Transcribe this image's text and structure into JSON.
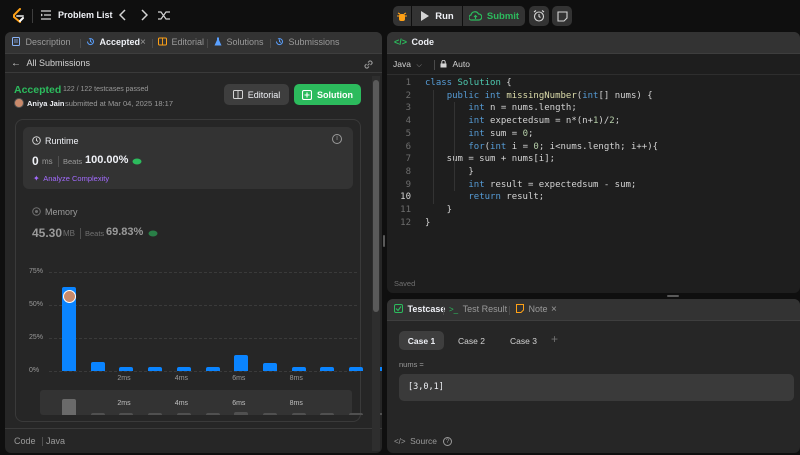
{
  "topbar": {
    "title": "Problem List",
    "run_label": "Run",
    "submit_label": "Submit"
  },
  "left_tabs": {
    "description": "Description",
    "accepted": "Accepted",
    "editorial": "Editorial",
    "solutions": "Solutions",
    "submissions": "Submissions"
  },
  "submission": {
    "back_label": "All Submissions",
    "status": "Accepted",
    "testcases": "122 / 122 testcases passed",
    "user": "Aniya Jain",
    "submitted_at": "submitted at Mar 04, 2025 18:17",
    "editorial_btn": "Editorial",
    "solution_btn": "Solution",
    "runtime_label": "Runtime",
    "runtime_value": "0",
    "runtime_unit": "ms",
    "beats_label": "Beats",
    "runtime_beats": "100.00%",
    "analyze_label": "Analyze Complexity",
    "memory_label": "Memory",
    "memory_value": "45.30",
    "memory_unit": "MB",
    "memory_beats": "69.83%",
    "footer_code": "Code",
    "footer_lang": "Java"
  },
  "chart_data": {
    "type": "bar",
    "ylim": [
      0,
      75
    ],
    "yticks": [
      "75%",
      "50%",
      "25%",
      "0%"
    ],
    "xtick_labels": [
      "2ms",
      "4ms",
      "6ms",
      "8ms"
    ],
    "values": [
      64,
      7,
      3,
      3,
      3,
      3,
      12,
      6,
      3,
      3,
      3,
      3
    ],
    "highlight_index": 0
  },
  "code_panel": {
    "title": "Code",
    "language": "Java",
    "auto_label": "Auto",
    "saved_label": "Saved",
    "lines": [
      "class Solution {",
      "    public int missingNumber(int[] nums) {",
      "        int n = nums.length;",
      "        int expectedsum = n*(n+1)/2;",
      "        int sum = 0;",
      "        for(int i = 0; i<nums.length; i++){",
      "    sum = sum + nums[i];",
      "        }",
      "        int result = expectedsum - sum;",
      "        return result;",
      "    }",
      "}"
    ],
    "active_line": 10
  },
  "test_panel": {
    "testcase_tab": "Testcase",
    "result_tab": "Test Result",
    "note_tab": "Note",
    "cases": [
      "Case 1",
      "Case 2",
      "Case 3"
    ],
    "add_label": "+",
    "param_name": "nums =",
    "param_value": "[3,0,1]",
    "source_label": "Source"
  },
  "colors": {
    "accent_green": "#2cbb5d",
    "accent_blue": "#0a84ff",
    "accent_orange": "#ffa116",
    "panel_bg": "#262626"
  }
}
